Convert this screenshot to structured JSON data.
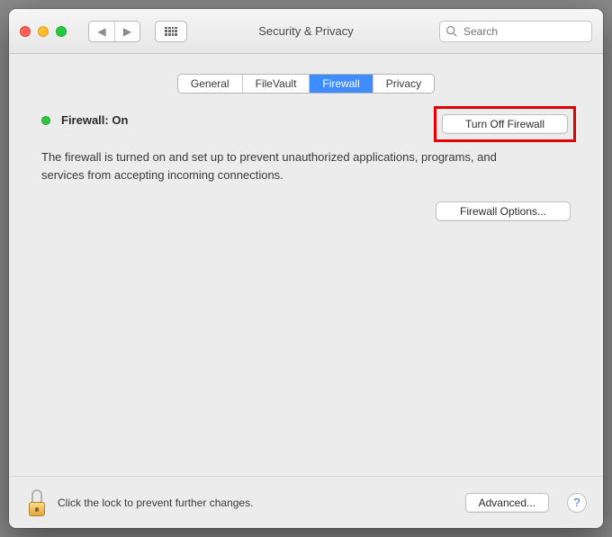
{
  "window": {
    "title": "Security & Privacy"
  },
  "toolbar": {
    "search_placeholder": "Search"
  },
  "tabs": {
    "general": "General",
    "filevault": "FileVault",
    "firewall": "Firewall",
    "privacy": "Privacy",
    "active": "firewall"
  },
  "firewall": {
    "status_label": "Firewall: On",
    "turn_off_label": "Turn Off Firewall",
    "description": "The firewall is turned on and set up to prevent unauthorized applications, programs, and services from accepting incoming connections.",
    "options_label": "Firewall Options..."
  },
  "footer": {
    "lock_text": "Click the lock to prevent further changes.",
    "advanced_label": "Advanced...",
    "help_label": "?"
  }
}
